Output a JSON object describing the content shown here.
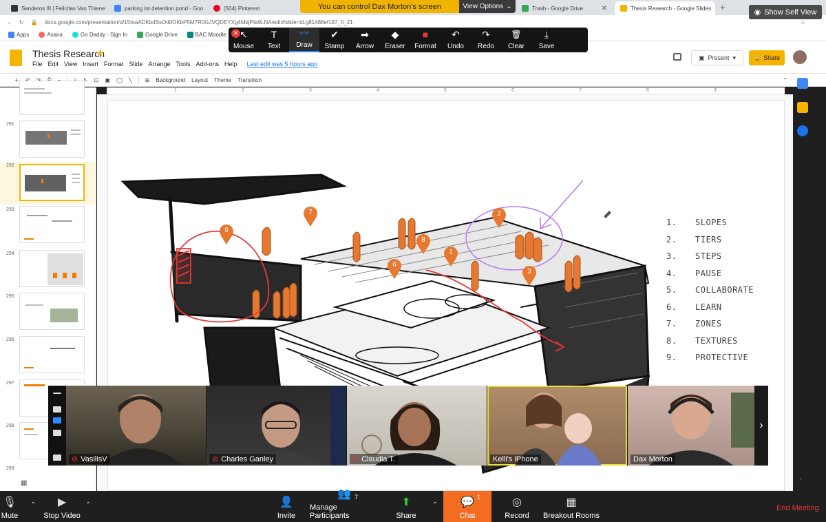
{
  "browser": {
    "tabs": [
      {
        "label": "Senderos III | Felicitas Van Thiene",
        "color": "#333333"
      },
      {
        "label": "parking lot detention pond - Goo",
        "color": "#4285f4"
      },
      {
        "label": "(504) Pinterest",
        "color": "#e60023"
      },
      {
        "label": "Trash - Google Drive",
        "color": "#34a853"
      },
      {
        "label": "Thesis Research - Google Slides",
        "color": "#f4b400"
      }
    ],
    "url": "docs.google.com/presentation/d/15toaADKbdSsOd0OKbP5M7R0GJVQDEYXg4MbjPta9LNA/edit#slide=id.g81488ef197_0_21",
    "bookmarks": [
      "Apps",
      "Asana",
      "Go Daddy - Sign In",
      "Google Drive",
      "BAC Moodle"
    ]
  },
  "zoom_overlay": {
    "control_banner": "You can control Dax Morton's screen",
    "view_options": "View Options",
    "show_self_view": "Show Self View"
  },
  "annotation_toolbar": {
    "tools": [
      {
        "label": "Mouse",
        "glyph": "↖"
      },
      {
        "label": "Text",
        "glyph": "T"
      },
      {
        "label": "Draw",
        "glyph": "〰"
      },
      {
        "label": "Stamp",
        "glyph": "✔"
      },
      {
        "label": "Arrow",
        "glyph": "➡"
      },
      {
        "label": "Eraser",
        "glyph": "◆"
      },
      {
        "label": "Format",
        "glyph": "■"
      },
      {
        "label": "Undo",
        "glyph": "↶"
      },
      {
        "label": "Redo",
        "glyph": "↷"
      },
      {
        "label": "Clear",
        "glyph": "🗑"
      },
      {
        "label": "Save",
        "glyph": "⤓"
      }
    ],
    "active_tool": "Draw",
    "format_color": "#e53935"
  },
  "slides": {
    "doc_title": "Thesis Research",
    "menu": [
      "File",
      "Edit",
      "View",
      "Insert",
      "Format",
      "Slide",
      "Arrange",
      "Tools",
      "Add-ons",
      "Help"
    ],
    "last_edit": "Last edit was 5 hours ago",
    "present_label": "Present",
    "share_label": "Share",
    "toolbar": [
      "Background",
      "Layout",
      "Theme",
      "Transition"
    ],
    "ruler": [
      "1",
      "2",
      "3",
      "4",
      "5",
      "6",
      "7",
      "8",
      "9"
    ],
    "filmstrip": [
      "291",
      "292",
      "293",
      "294",
      "295",
      "296",
      "297",
      "298",
      "299"
    ],
    "selected_slide": "292"
  },
  "slide_content": {
    "list": [
      {
        "n": "1.",
        "label": "SLOPES"
      },
      {
        "n": "2.",
        "label": "TIERS"
      },
      {
        "n": "3.",
        "label": "STEPS"
      },
      {
        "n": "4.",
        "label": "PAUSE"
      },
      {
        "n": "5.",
        "label": "COLLABORATE"
      },
      {
        "n": "6.",
        "label": "LEARN"
      },
      {
        "n": "7.",
        "label": "ZONES"
      },
      {
        "n": "8.",
        "label": "TEXTURES"
      },
      {
        "n": "9.",
        "label": "PROTECTIVE"
      }
    ],
    "markers": [
      "1",
      "2",
      "3",
      "6",
      "7",
      "8",
      "9"
    ],
    "marker_color": "#e6782f",
    "annotation_colors": {
      "red": "#e53935",
      "purple": "#b57cf0"
    }
  },
  "participants": [
    {
      "name": "VasilisV",
      "muted": true,
      "speaking": false
    },
    {
      "name": "Charles Ganley",
      "muted": true,
      "speaking": false
    },
    {
      "name": "Claudia T.",
      "muted": true,
      "speaking": false
    },
    {
      "name": "Kelli's iPhone",
      "muted": false,
      "speaking": true
    },
    {
      "name": "Dax Morton",
      "muted": false,
      "speaking": false
    }
  ],
  "zoom_bar": {
    "mute": "Mute",
    "stop_video": "Stop Video",
    "invite": "Invite",
    "manage_participants": "Manage Participants",
    "participant_count": "7",
    "share": "Share",
    "chat": "Chat",
    "chat_count": "1",
    "record": "Record",
    "breakout_rooms": "Breakout Rooms",
    "end_meeting": "End Meeting"
  }
}
